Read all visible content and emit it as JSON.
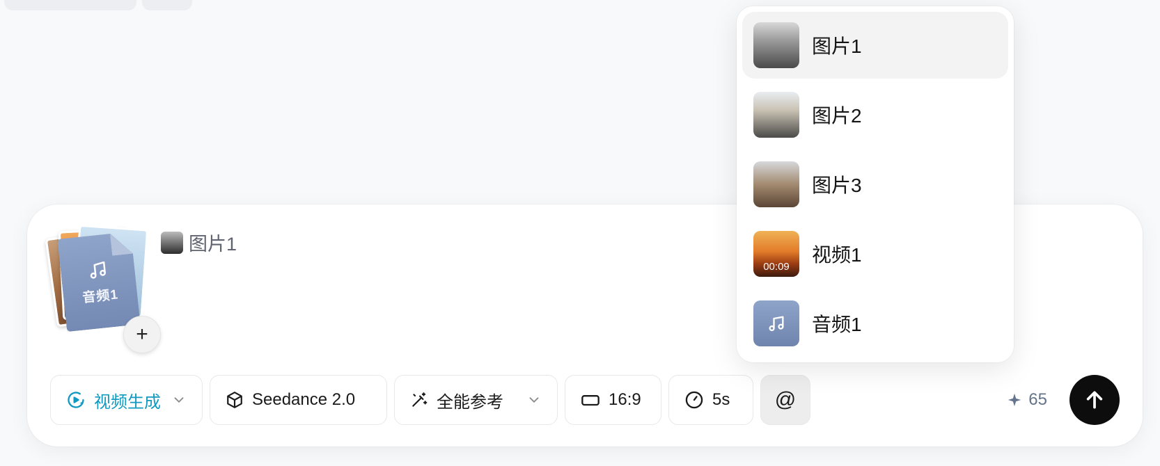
{
  "composer": {
    "attachment": {
      "audio_label": "音频1"
    },
    "mention": {
      "label": "图片1"
    }
  },
  "toolbar": {
    "mode": {
      "label": "视频生成",
      "icon": "video-sparkle-icon"
    },
    "model": {
      "label": "Seedance 2.0",
      "icon": "cube-icon"
    },
    "reference": {
      "label": "全能参考",
      "icon": "magic-wand-icon"
    },
    "ratio": {
      "label": "16:9",
      "icon": "aspect-ratio-icon"
    },
    "duration": {
      "label": "5s",
      "icon": "clock-icon"
    },
    "mention_button": {
      "label": "@"
    },
    "credits": {
      "value": "65",
      "icon": "sparkle-icon"
    },
    "send": {
      "icon": "arrow-up-icon"
    }
  },
  "dropdown": {
    "items": [
      {
        "label": "图片1",
        "kind": "image",
        "active": true
      },
      {
        "label": "图片2",
        "kind": "image"
      },
      {
        "label": "图片3",
        "kind": "image"
      },
      {
        "label": "视频1",
        "kind": "video",
        "duration": "00:09"
      },
      {
        "label": "音频1",
        "kind": "audio"
      }
    ]
  },
  "colors": {
    "accent": "#109ac0",
    "send_bg": "#0d0d0d",
    "audio_card": "#8094bf"
  }
}
